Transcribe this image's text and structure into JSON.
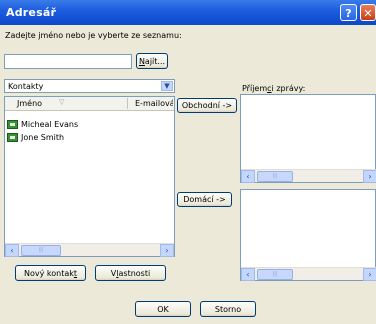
{
  "window": {
    "title": "Adresář",
    "help_label": "?",
    "close_label": "✕"
  },
  "search": {
    "prompt_pre": "Zade",
    "prompt_key": "j",
    "prompt_post": "te jméno nebo je vyberte ze seznamu:",
    "value": "",
    "find_pre": "",
    "find_key": "N",
    "find_post": "ajít..."
  },
  "folder_select": {
    "value": "Kontakty"
  },
  "contacts": {
    "columns": [
      {
        "label": "Jméno"
      },
      {
        "label": "E-mailová"
      }
    ],
    "rows": [
      {
        "name": "Micheal Evans"
      },
      {
        "name": "Jone Smith"
      }
    ]
  },
  "actions": {
    "new_contact_pre": "Nový kontak",
    "new_contact_key": "t",
    "new_contact_post": "",
    "properties_pre": "V",
    "properties_key": "l",
    "properties_post": "astnosti"
  },
  "recipients": {
    "label_pre": "Příjem",
    "label_key": "c",
    "label_post": "i zprávy:",
    "business_button": "Obchodní ->",
    "home_button": "Domácí ->"
  },
  "footer": {
    "ok": "OK",
    "cancel": "Storno"
  },
  "colors": {
    "titlebar": "#0c48c8",
    "dialog_bg": "#ece9d8",
    "border": "#7f9db9"
  }
}
